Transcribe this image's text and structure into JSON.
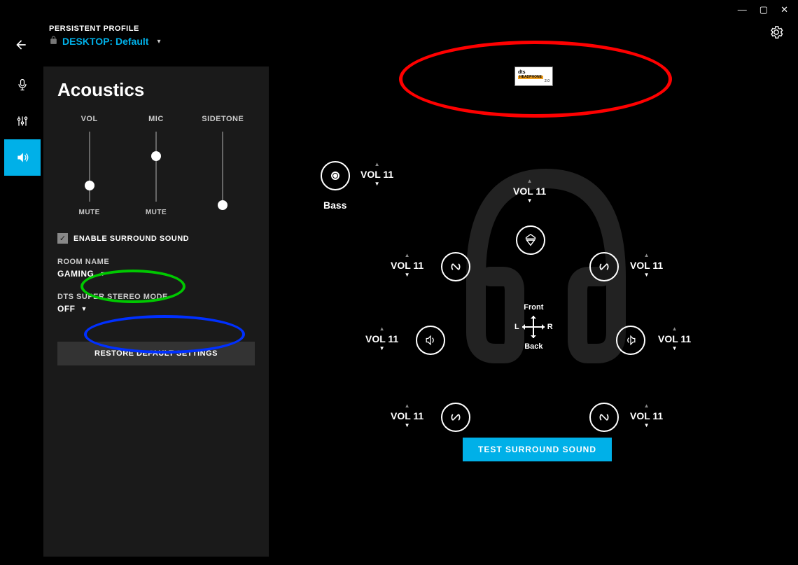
{
  "window": {
    "minimize": "—",
    "maximize": "▢",
    "close": "✕"
  },
  "header": {
    "profile_label": "PERSISTENT PROFILE",
    "profile_prefix": "DESKTOP:",
    "profile_value": "Default"
  },
  "nav": {
    "active_index": 2
  },
  "panel": {
    "title": "Acoustics",
    "sliders": {
      "vol": {
        "label": "VOL",
        "mute": "MUTE",
        "pos": 70
      },
      "mic": {
        "label": "MIC",
        "mute": "MUTE",
        "pos": 28
      },
      "sidetone": {
        "label": "SIDETONE",
        "pos": 98
      }
    },
    "surround_checkbox": "ENABLE SURROUND SOUND",
    "room": {
      "label": "ROOM NAME",
      "value": "GAMING"
    },
    "dts": {
      "label": "DTS SUPER STEREO MODE",
      "value": "OFF"
    },
    "restore": "RESTORE DEFAULT SETTINGS"
  },
  "badge": {
    "line1": "dts",
    "line2": "HEADPHONE",
    "line3": "2.0"
  },
  "surround": {
    "bass_vol": "VOL 11",
    "bass_label": "Bass",
    "center_vol": "VOL 11",
    "front_left_vol": "VOL 11",
    "front_right_vol": "VOL 11",
    "side_left_vol": "VOL 11",
    "side_right_vol": "VOL 11",
    "rear_left_vol": "VOL 11",
    "rear_right_vol": "VOL 11",
    "front_label": "Front",
    "back_label": "Back",
    "left_label": "L",
    "right_label": "R",
    "test_button": "TEST SURROUND SOUND"
  }
}
